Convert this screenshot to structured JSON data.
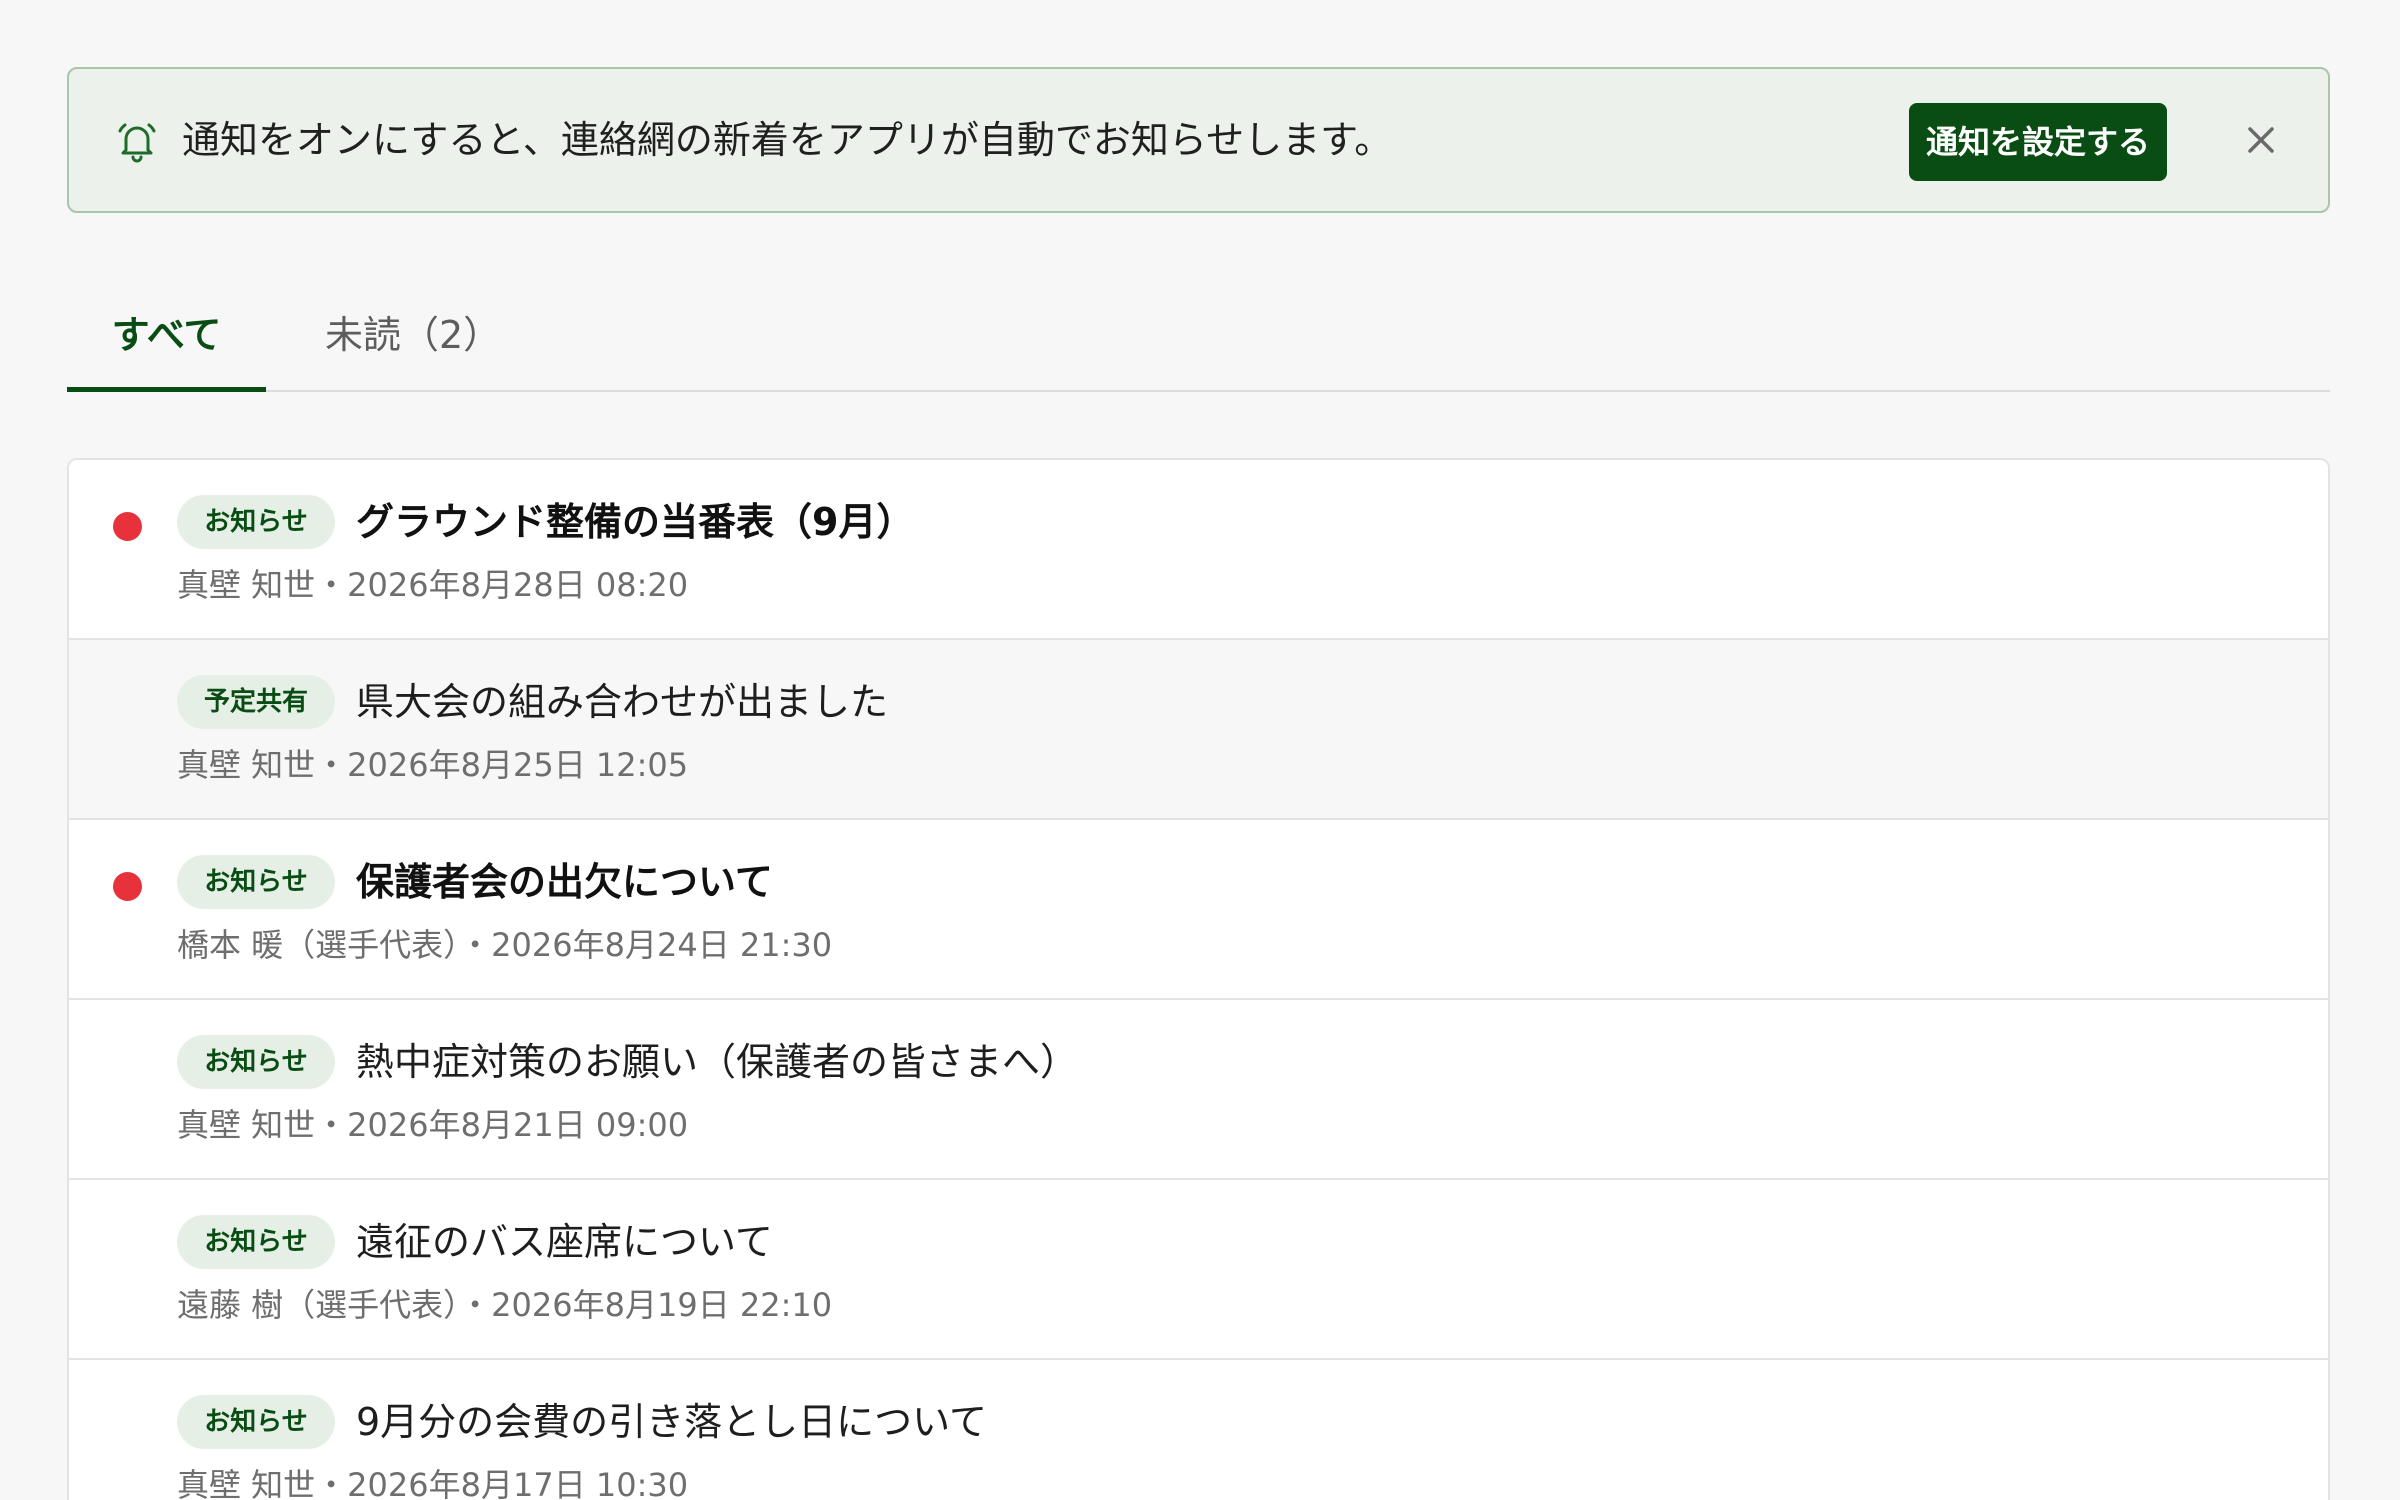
{
  "banner": {
    "icon": "bell-icon",
    "message": "通知をオンにすると、連絡網の新着をアプリが自動でお知らせします。",
    "cta_label": "通知を設定する",
    "close_icon": "close-icon",
    "background_color": "#ecf1ec",
    "border_color": "#a8c6aa",
    "cta_color": "#0a4d14"
  },
  "tabs": [
    {
      "label": "すべて",
      "selected": true
    },
    {
      "label": "未読（2）",
      "selected": false
    }
  ],
  "accent_color": "#0a4d14",
  "unread_color": "#e8323b",
  "messages": [
    {
      "unread": true,
      "tag": "お知らせ",
      "title": "グラウンド整備の当番表（9月）",
      "meta": "真壁 知世・2026年8月28日 08:20"
    },
    {
      "unread": false,
      "tag": "予定共有",
      "title": "県大会の組み合わせが出ました",
      "meta": "真壁 知世・2026年8月25日 12:05"
    },
    {
      "unread": true,
      "tag": "お知らせ",
      "title": "保護者会の出欠について",
      "meta": "橋本 暖（選手代表）・2026年8月24日 21:30"
    },
    {
      "unread": false,
      "tag": "お知らせ",
      "title": "熱中症対策のお願い（保護者の皆さまへ）",
      "meta": "真壁 知世・2026年8月21日 09:00"
    },
    {
      "unread": false,
      "tag": "お知らせ",
      "title": "遠征のバス座席について",
      "meta": "遠藤 樹（選手代表）・2026年8月19日 22:10"
    },
    {
      "unread": false,
      "tag": "お知らせ",
      "title": "9月分の会費の引き落とし日について",
      "meta": "真壁 知世・2026年8月17日 10:30"
    }
  ]
}
